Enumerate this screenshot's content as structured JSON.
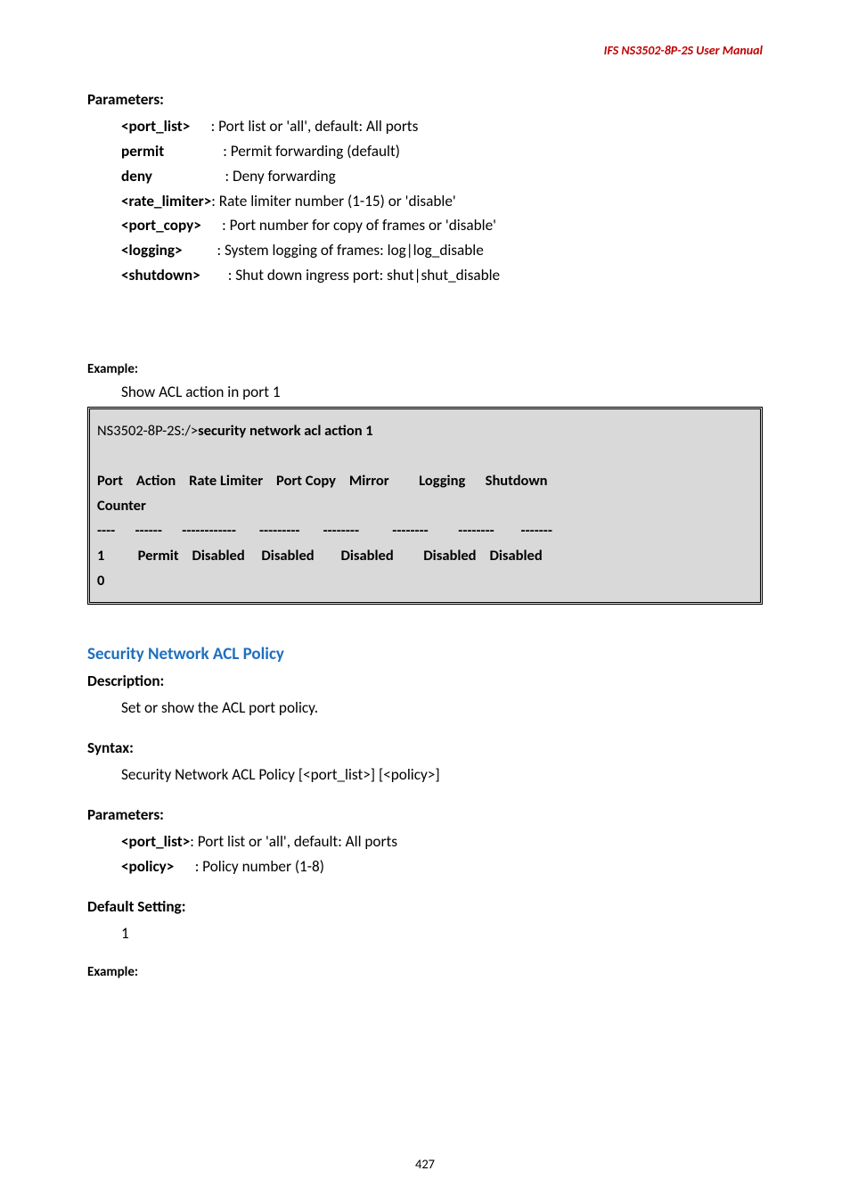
{
  "header": {
    "title": "IFS NS3502-8P-2S  User  Manual"
  },
  "parameters": {
    "heading": "Parameters:",
    "rows": [
      {
        "key": "<port_list>",
        "sep": "      ",
        "val": ": Port list or 'all', default: All ports"
      },
      {
        "key": "permit",
        "sep": "                 ",
        "val": ": Permit forwarding (default)"
      },
      {
        "key": "deny",
        "sep": "                     ",
        "val": ": Deny forwarding"
      },
      {
        "key": "<rate_limiter>",
        "sep": "",
        "val": ": Rate limiter number (1-15) or 'disable'"
      },
      {
        "key": "<port_copy>",
        "sep": "      ",
        "val": ": Port number for copy of frames or 'disable'"
      },
      {
        "key": "<logging>",
        "sep": "          ",
        "val": ": System logging of frames: log|log_disable"
      },
      {
        "key": "<shutdown>",
        "sep": "        ",
        "val": ": Shut down ingress port: shut|shut_disable"
      }
    ]
  },
  "example1": {
    "label": "Example:",
    "caption": "Show ACL action in port 1",
    "lines": [
      {
        "pre": "NS3502-8P-2S:/>",
        "cmd": "security network acl action 1",
        "bold_cmd": true
      },
      {
        "pre": "",
        "cmd": "",
        "bold_cmd": false
      },
      {
        "pre": "Port    Action    Rate Limiter    Port Copy    Mirror         Logging      Shutdown",
        "cmd": "",
        "bold_cmd": false,
        "bold_line": true
      },
      {
        "pre": "Counter",
        "cmd": "",
        "bold_cmd": false,
        "bold_line": true
      },
      {
        "pre": "----      ------      ------------       ---------       --------          --------         --------        -------",
        "cmd": "",
        "bold_cmd": false,
        "bold_line": true
      },
      {
        "pre": "1          Permit    Disabled     Disabled        Disabled         Disabled    Disabled",
        "cmd": "",
        "bold_cmd": false,
        "bold_line": true
      },
      {
        "pre": "0",
        "cmd": "",
        "bold_cmd": false,
        "bold_line": true
      }
    ]
  },
  "policy": {
    "heading": "Security Network ACL Policy",
    "description": {
      "label": "Description:",
      "text": "Set or show the ACL port policy."
    },
    "syntax": {
      "label": "Syntax:",
      "text": "Security Network ACL Policy [<port_list>] [<policy>]"
    },
    "parameters": {
      "label": "Parameters:",
      "rows": [
        {
          "key": "<port_list>",
          "sep": "",
          "val": ": Port list or 'all', default: All ports"
        },
        {
          "key": "<policy>",
          "sep": "      ",
          "val": ": Policy number (1-8)"
        }
      ]
    },
    "default": {
      "label": "Default Setting:",
      "text": "1"
    },
    "example_label": "Example:"
  },
  "footer": {
    "page": "427"
  }
}
